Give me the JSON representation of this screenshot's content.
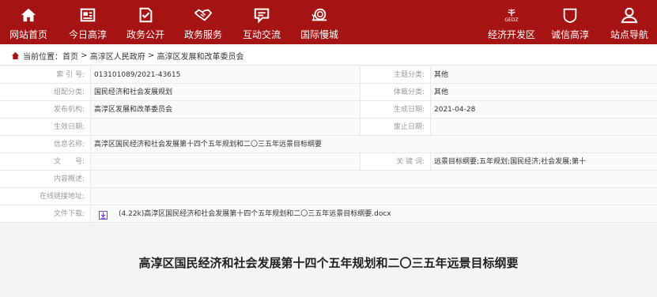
{
  "nav": {
    "left": [
      {
        "label": "网站首页",
        "icon": "home-icon"
      },
      {
        "label": "今日高淳",
        "icon": "newspaper-icon"
      },
      {
        "label": "政务公开",
        "icon": "checklist-icon"
      },
      {
        "label": "政务服务",
        "icon": "handshake-icon"
      },
      {
        "label": "互动交流",
        "icon": "chat-icon"
      },
      {
        "label": "国际慢城",
        "icon": "snail-icon"
      }
    ],
    "right": [
      {
        "label": "经济开发区",
        "icon": "gedz-logo-icon",
        "icon_text": "GEDZ"
      },
      {
        "label": "诚信高淳",
        "icon": "integrity-icon",
        "icon_text": "诚"
      },
      {
        "label": "站点导航",
        "icon": "user-nav-icon"
      }
    ]
  },
  "breadcrumb": {
    "prefix": "当前位置：",
    "items": [
      "首页",
      "高淳区人民政府",
      "高淳区发展和改革委员会"
    ],
    "separator": " > "
  },
  "info": {
    "index_label": "索 引 号:",
    "index_value": "013101089/2021-43615",
    "topic_label": "主题分类:",
    "topic_value": "其他",
    "group_label": "组配分类:",
    "group_value": "国民经济和社会发展规划",
    "genre_label": "体裁分类:",
    "genre_value": "其他",
    "publisher_label": "发布机构:",
    "publisher_value": "高淳区发展和改革委员会",
    "created_label": "生成日期:",
    "created_value": "2021-04-28",
    "effective_label": "生效日期:",
    "effective_value": "",
    "abolish_label": "废止日期:",
    "abolish_value": "",
    "name_label": "信息名称:",
    "name_value": "高淳区国民经济和社会发展第十四个五年规划和二〇三五年远景目标纲要",
    "docno_label": "文　　号:",
    "docno_value": "",
    "keywords_label": "关 键 词:",
    "keywords_value": "远景目标纲要;五年规划;国民经济;社会发展;第十",
    "summary_label": "内容概述:",
    "summary_value": "",
    "link_label": "在线链接地址:",
    "link_value": "",
    "download_label": "文件下载:",
    "download_value": "(4.22k)高淳区国民经济和社会发展第十四个五年规划和二〇三五年远景目标纲要.docx"
  },
  "doc_title": "高淳区国民经济和社会发展第十四个五年规划和二〇三五年远景目标纲要",
  "colors": {
    "brand_red": "#a61313",
    "accent_purple": "#6a38c8"
  }
}
